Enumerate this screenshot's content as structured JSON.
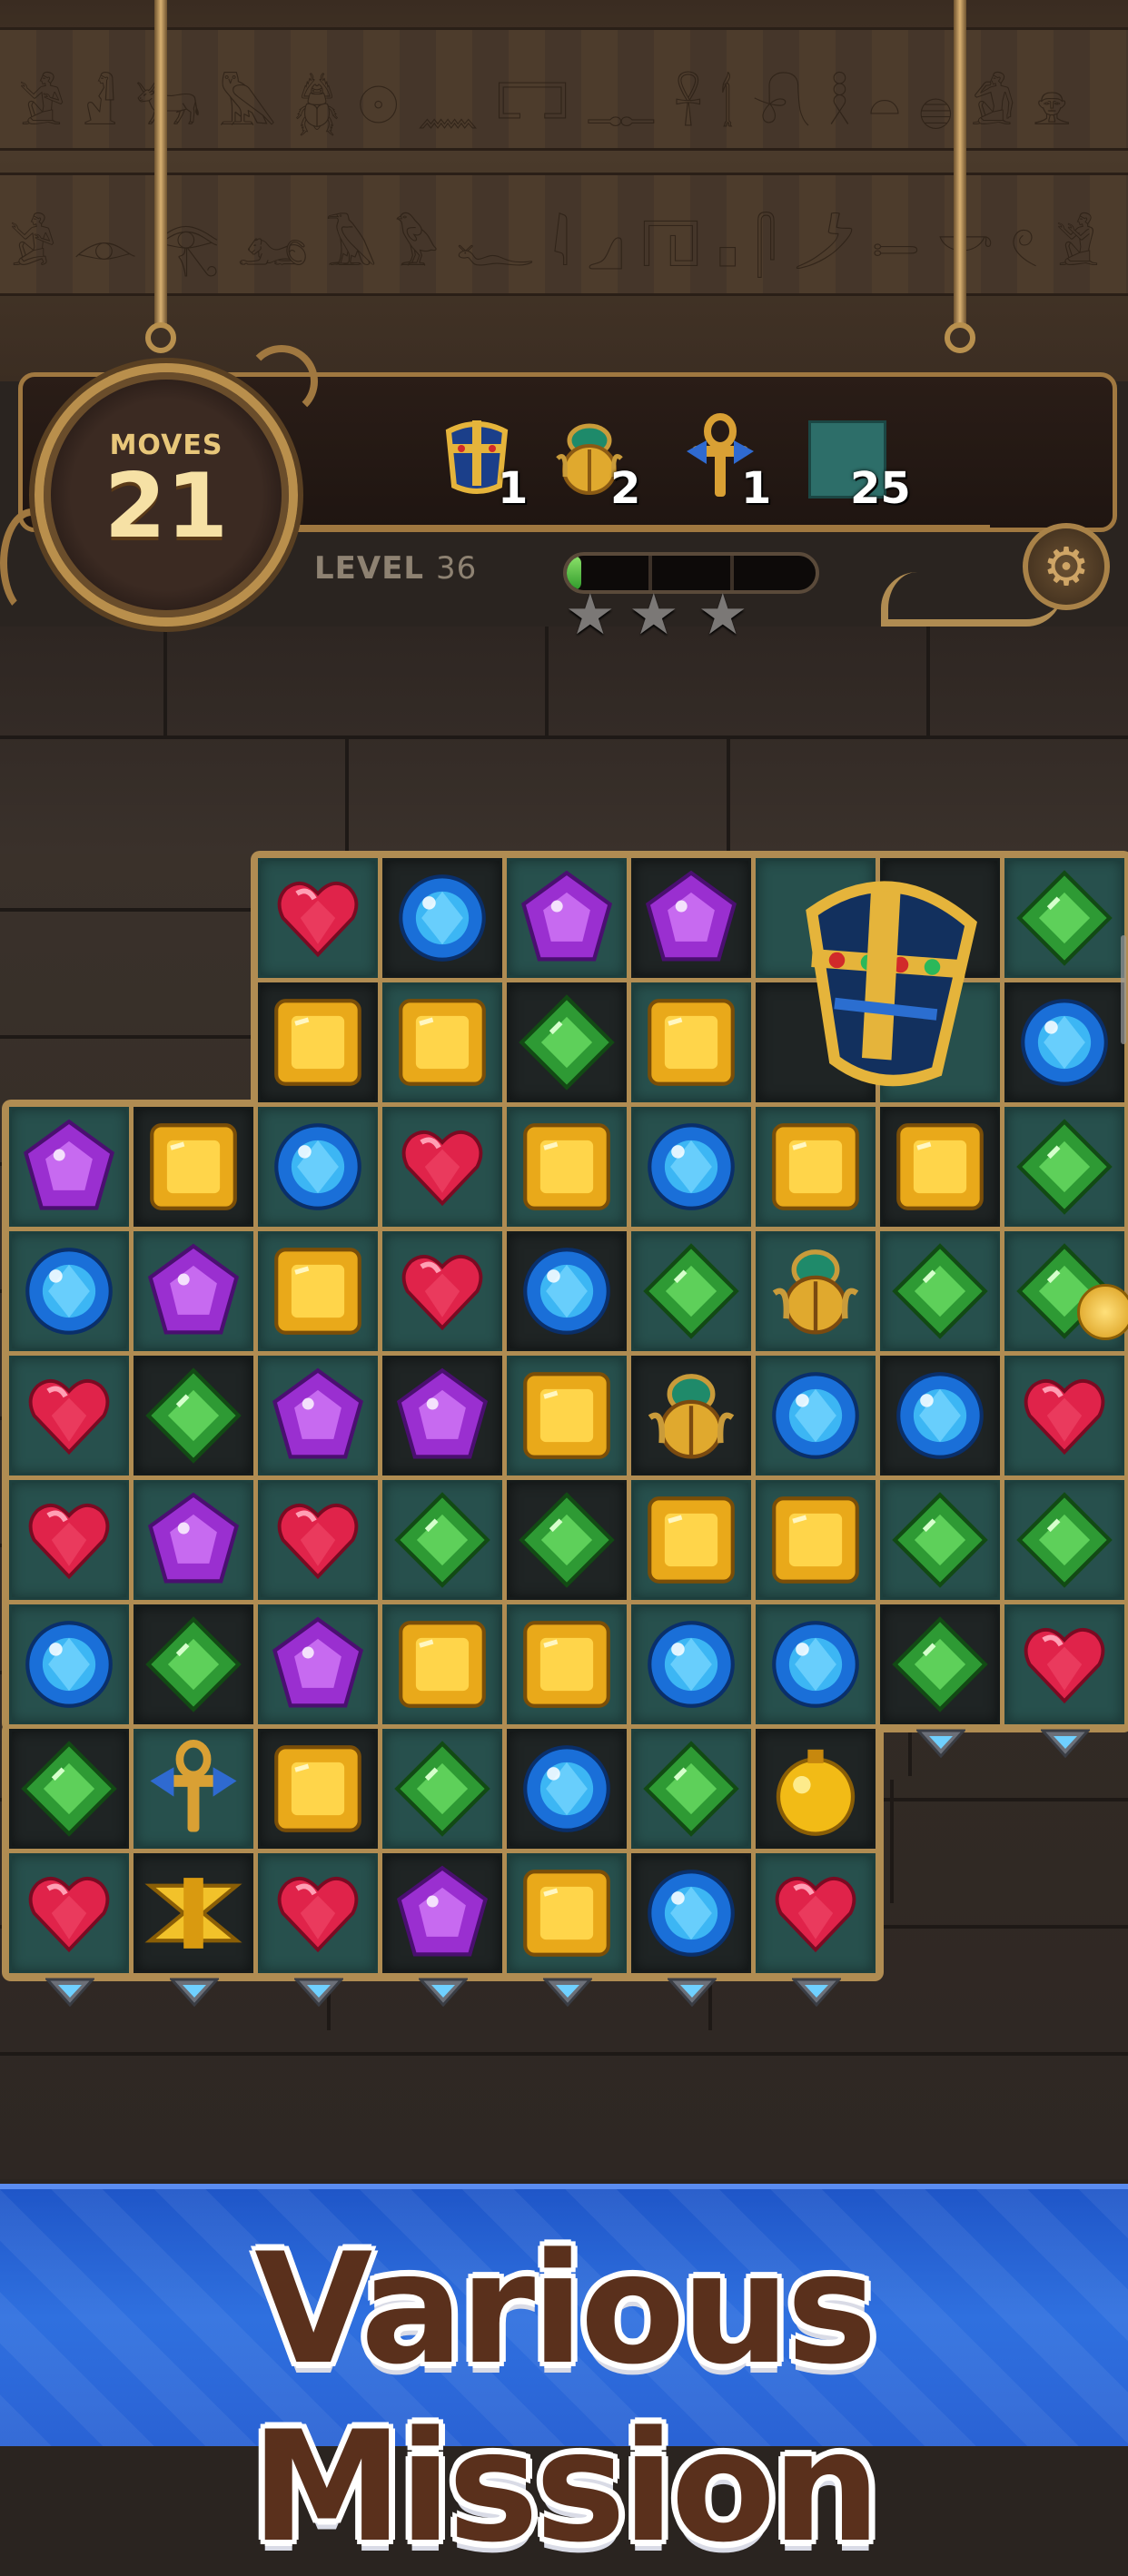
{
  "hud": {
    "moves_label": "MOVES",
    "moves_value": "21",
    "level_label": "LEVEL",
    "level_value": "36",
    "goals": [
      {
        "icon": "pharaoh-crown-icon",
        "count": "1"
      },
      {
        "icon": "scarab-icon",
        "count": "2"
      },
      {
        "icon": "ankh-icon",
        "count": "1"
      },
      {
        "icon": "teal-tile-icon",
        "count": "25"
      }
    ],
    "progress": 0.06,
    "stars_earned": 0,
    "stars_total": 3
  },
  "board": {
    "legend": {
      "R": "red-heart-gem",
      "B": "blue-round-gem",
      "P": "purple-pentagon-gem",
      "G": "green-diamond-gem",
      "Y": "yellow-square-gem",
      "S": "scarab-piece",
      "A": "ankh-piece",
      "O": "golden-orb-piece",
      "H": "gold-hourglass-piece",
      "C": "pharaoh-crown-piece",
      "_": "empty"
    },
    "rows": [
      [
        "_",
        "_",
        "R",
        "B",
        "P",
        "P",
        "C",
        "C",
        "G"
      ],
      [
        "_",
        "_",
        "Y",
        "Y",
        "G",
        "Y",
        "C",
        "C",
        "B"
      ],
      [
        "P",
        "Y",
        "B",
        "R",
        "Y",
        "B",
        "Y",
        "Y",
        "G"
      ],
      [
        "B",
        "P",
        "Y",
        "R",
        "B",
        "G",
        "S",
        "G",
        "G"
      ],
      [
        "R",
        "G",
        "P",
        "P",
        "Y",
        "S",
        "B",
        "B",
        "R"
      ],
      [
        "R",
        "P",
        "R",
        "G",
        "G",
        "Y",
        "Y",
        "G",
        "G"
      ],
      [
        "B",
        "G",
        "P",
        "Y",
        "Y",
        "B",
        "B",
        "G",
        "R"
      ],
      [
        "G",
        "A",
        "Y",
        "G",
        "B",
        "G",
        "O",
        "_",
        "_"
      ],
      [
        "R",
        "H",
        "R",
        "P",
        "Y",
        "B",
        "R",
        "_",
        "_"
      ]
    ]
  },
  "banner": {
    "text": "Various Mission"
  },
  "colors": {
    "panel_gold": "#a07840",
    "board_teal": "#27504d",
    "banner_blue": "#2f70df",
    "banner_text": "#5a301c"
  }
}
